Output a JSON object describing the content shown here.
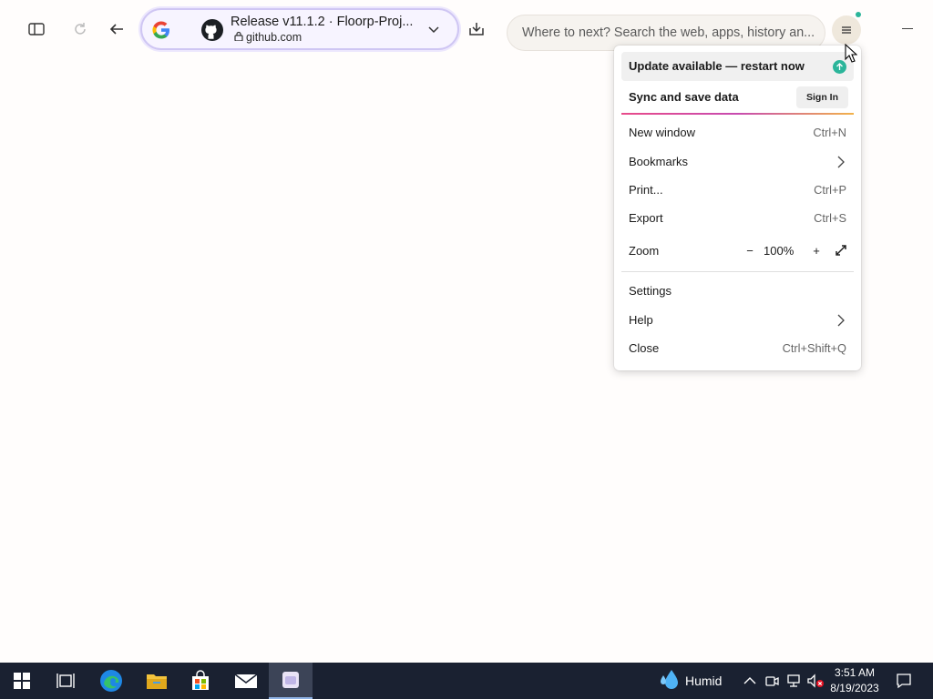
{
  "browser": {
    "tab": {
      "title": "Release v11.1.2 · Floorp-Proj...",
      "host": "github.com"
    },
    "search_placeholder": "Where to next? Search the web, apps, history an...",
    "icons": {
      "sidebar": "sidebar-icon",
      "reload": "reload-icon",
      "back": "back-arrow-icon",
      "google": "google-icon",
      "github": "github-icon",
      "lock": "lock-icon",
      "downloads": "download-icon",
      "menu": "hamburger-menu-icon"
    }
  },
  "app_menu": {
    "update": "Update available — restart now",
    "sync": {
      "label": "Sync and save data",
      "button": "Sign In"
    },
    "items": [
      {
        "label": "New window",
        "shortcut": "Ctrl+N"
      },
      {
        "label": "Bookmarks",
        "shortcut": ""
      },
      {
        "label": "Print...",
        "shortcut": "Ctrl+P"
      },
      {
        "label": "Export",
        "shortcut": "Ctrl+S"
      }
    ],
    "zoom": {
      "label": "Zoom",
      "minus": "−",
      "value": "100%",
      "plus": "+"
    },
    "bottom_items": [
      {
        "label": "Settings",
        "shortcut": ""
      },
      {
        "label": "Help",
        "shortcut": ""
      },
      {
        "label": "Close",
        "shortcut": "Ctrl+Shift+Q"
      }
    ]
  },
  "taskbar": {
    "weather": "Humid",
    "time": "3:51 AM",
    "date": "8/19/2023",
    "apps": [
      "start-icon",
      "task-view-icon",
      "edge-icon",
      "file-explorer-icon",
      "store-icon",
      "mail-icon",
      "floorp-icon"
    ]
  },
  "colors": {
    "accent_green": "#2bb59a",
    "taskbar": "#1a2131",
    "urlbar_border": "#cfc6f3"
  }
}
